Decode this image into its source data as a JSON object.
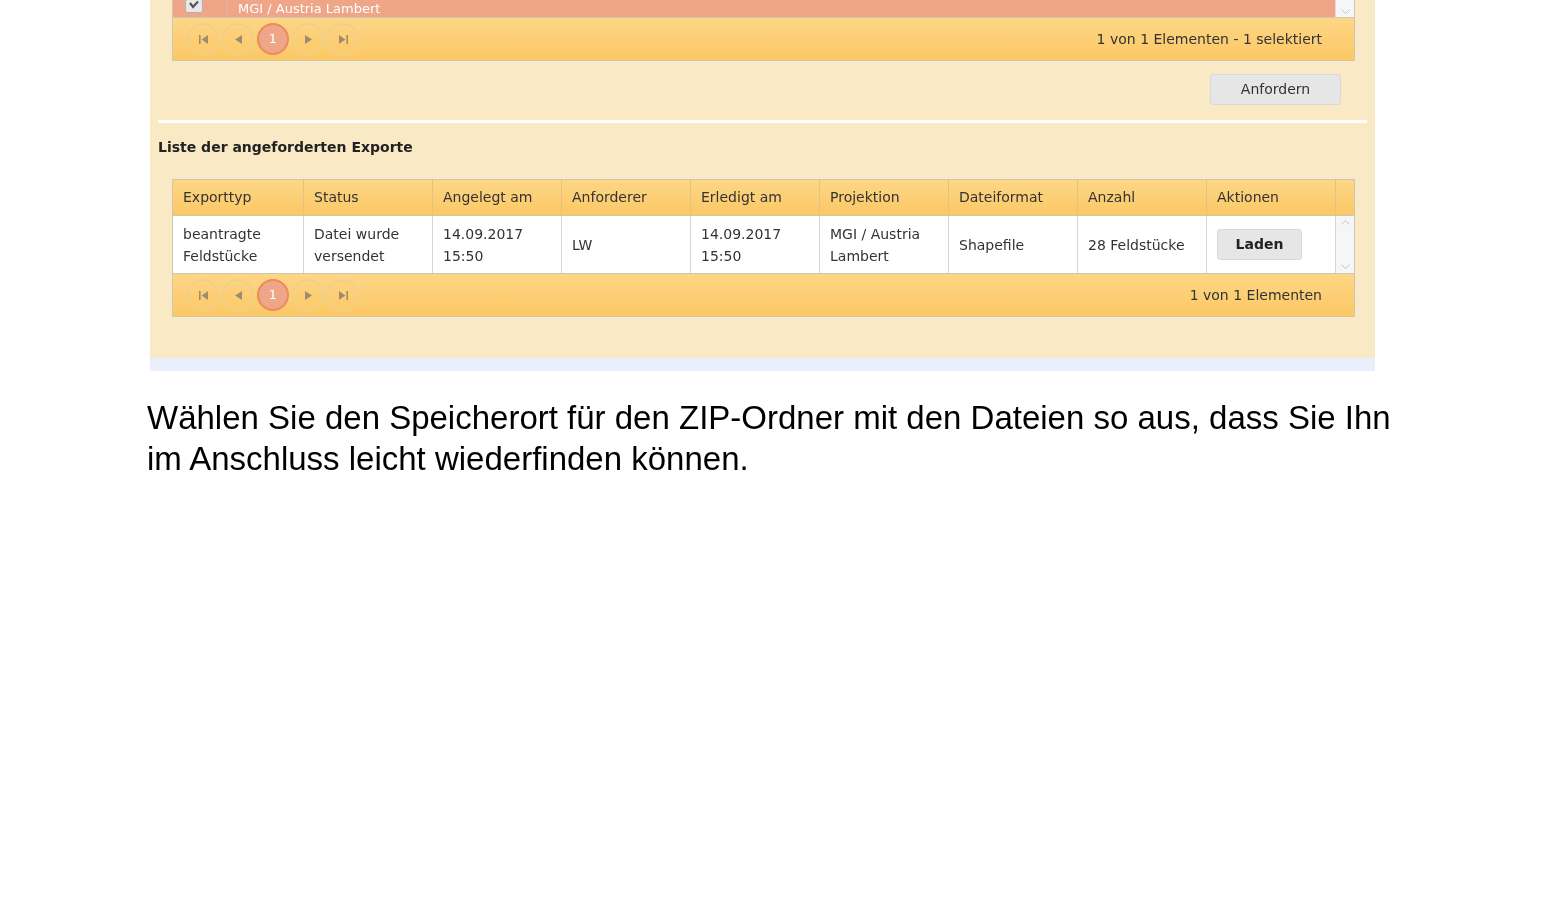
{
  "selected_table": {
    "rows": [
      {
        "selected": true,
        "checked": true,
        "cells": [
          "MGI / Austria Lambert"
        ]
      }
    ],
    "pager": {
      "pages": [
        {
          "label": "1",
          "selected": true
        }
      ],
      "summary": "1 von 1 Elementen - 1 selektiert"
    }
  },
  "request_button": {
    "label": "Anfordern"
  },
  "requested_exports": {
    "title": "Liste der angeforderten Exporte",
    "columns": [
      "Exporttyp",
      "Status",
      "Angelegt am",
      "Anforderer",
      "Erledigt am",
      "Projektion",
      "Dateiformat",
      "Anzahl",
      "Aktionen"
    ],
    "rows": [
      {
        "cells": [
          "beantragte Feldstücke",
          "Datei wurde versendet",
          "14.09.2017 15:50",
          "LW",
          "14.09.2017 15:50",
          "MGI / Austria Lambert",
          "Shapefile",
          "28 Feldstücke"
        ],
        "action": "Laden"
      }
    ],
    "pager": {
      "pages": [
        {
          "label": "1",
          "selected": true
        }
      ],
      "summary": "1 von 1 Elementen"
    }
  },
  "instruction": "Wählen Sie den Speicherort für den ZIP-Ordner mit den Dateien so aus, dass Sie Ihn im Anschluss leicht wiederfinden können."
}
